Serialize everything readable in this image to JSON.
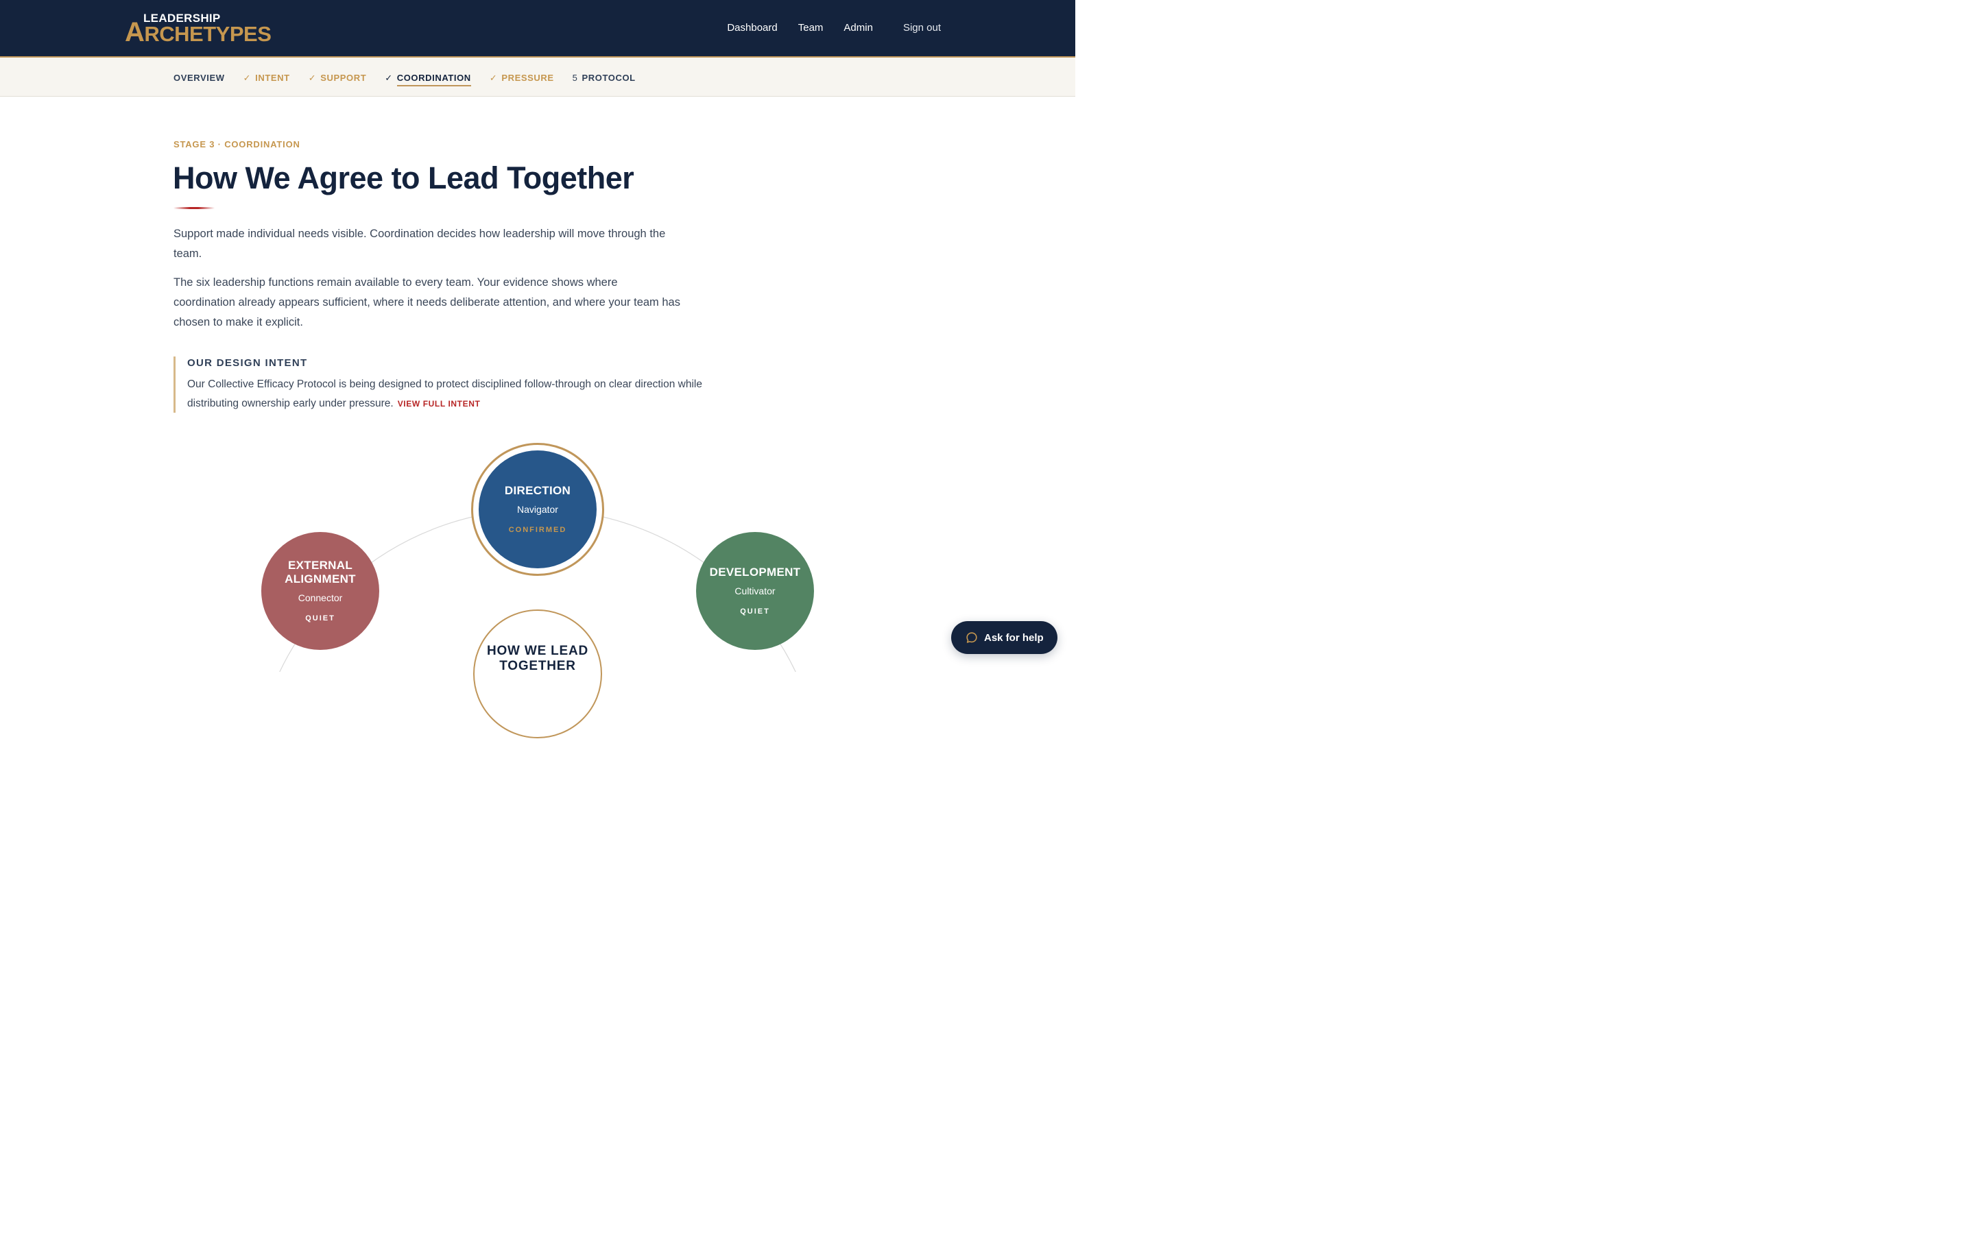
{
  "app": {
    "logo_top": "LEADERSHIP",
    "logo_first_letter": "A",
    "logo_rest": "RCHETYPES"
  },
  "nav": {
    "dashboard": "Dashboard",
    "team": "Team",
    "admin": "Admin",
    "signout": "Sign out"
  },
  "stepper": {
    "steps": [
      {
        "mark": "",
        "label": "OVERVIEW",
        "state": "plain"
      },
      {
        "mark": "✓",
        "label": "INTENT",
        "state": "done"
      },
      {
        "mark": "✓",
        "label": "SUPPORT",
        "state": "done"
      },
      {
        "mark": "✓",
        "label": "COORDINATION",
        "state": "active"
      },
      {
        "mark": "✓",
        "label": "PRESSURE",
        "state": "done"
      },
      {
        "mark": "5",
        "label": "PROTOCOL",
        "state": "plain"
      }
    ]
  },
  "main": {
    "eyebrow": "STAGE 3 · COORDINATION",
    "title": "How We Agree to Lead Together",
    "paragraph1": "Support made individual needs visible. Coordination decides how leadership will move through the team.",
    "paragraph2": "The six leadership functions remain available to every team. Your evidence shows where coordination already appears sufficient, where it needs deliberate attention, and where your team has chosen to make it explicit."
  },
  "intent": {
    "title": "OUR DESIGN INTENT",
    "text": "Our Collective Efficacy Protocol is being designed to protect disciplined follow-through on clear direction while distributing ownership early under pressure.",
    "link": "VIEW FULL INTENT"
  },
  "diagram": {
    "center_title": "HOW WE LEAD TOGETHER",
    "nodes": {
      "direction": {
        "title": "DIRECTION",
        "archetype": "Navigator",
        "status": "CONFIRMED",
        "color": "#27578a"
      },
      "external": {
        "title": "EXTERNAL ALIGNMENT",
        "archetype": "Connector",
        "status": "QUIET",
        "color": "#a85f61"
      },
      "development": {
        "title": "DEVELOPMENT",
        "archetype": "Cultivator",
        "status": "QUIET",
        "color": "#538463"
      }
    }
  },
  "help": {
    "label": "Ask for help",
    "icon": "chat-bubble-icon"
  },
  "colors": {
    "navy": "#14233d",
    "gold": "#c6974f",
    "accent_red": "#b72626"
  }
}
